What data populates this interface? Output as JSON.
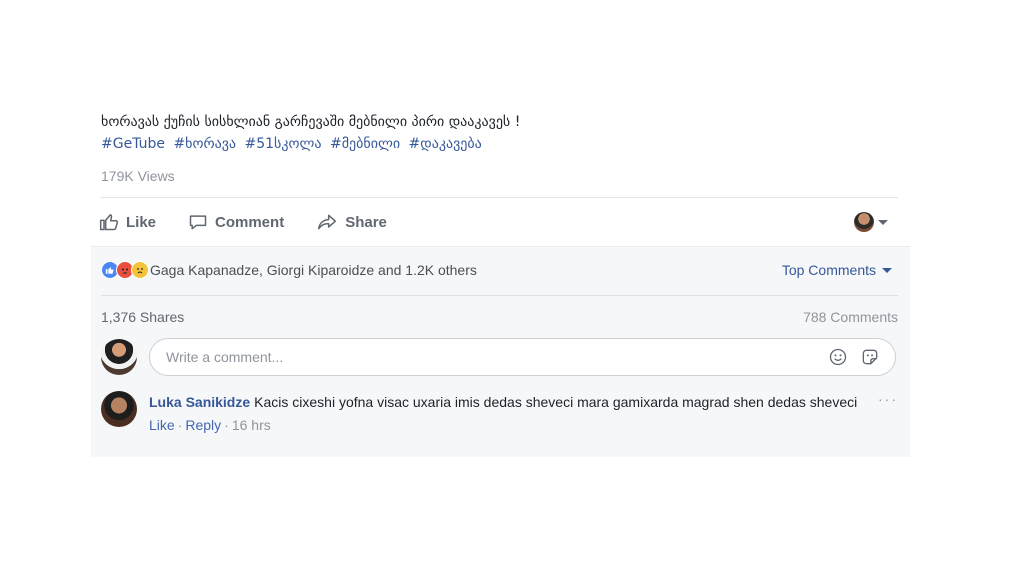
{
  "post": {
    "title": "ხორავას ქუჩის სისხლიან გარჩევაში მებნილი პირი დააკავეს !",
    "hashtags": [
      "#GeTube",
      "#ხორავა",
      "#51სკოლა",
      "#მებნილი",
      "#დაკავება"
    ],
    "views": "179K Views"
  },
  "actions": {
    "like": "Like",
    "comment": "Comment",
    "share": "Share"
  },
  "reactions": {
    "summary": "Gaga Kapanadze, Giorgi Kiparoidze and 1.2K others",
    "sort_label": "Top Comments"
  },
  "counts": {
    "shares": "1,376 Shares",
    "comments": "788 Comments"
  },
  "composer": {
    "placeholder": "Write a comment..."
  },
  "comment": {
    "author": "Luka Sanikidze",
    "text": "Kacis cixeshi yofna visac uxaria imis dedas sheveci mara gamixarda magrad shen dedas sheveci",
    "like_label": "Like",
    "reply_label": "Reply",
    "time": "16 hrs",
    "options": "···"
  },
  "icons": {
    "like": "thumbs-up-icon",
    "comment": "speech-bubble-icon",
    "share": "share-arrow-icon",
    "emoji": "smiley-icon",
    "sticker": "sticker-icon"
  }
}
